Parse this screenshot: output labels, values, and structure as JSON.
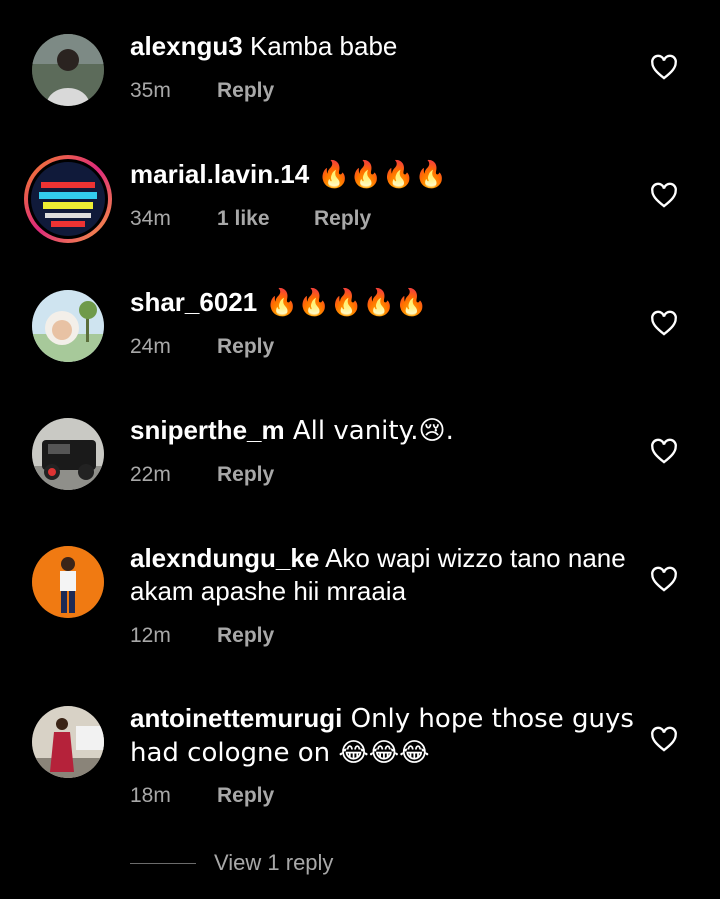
{
  "comments": [
    {
      "username": "alexngu3",
      "text": " Kamba babe",
      "time": "35m",
      "likes": "",
      "reply": "Reply",
      "avatar": "person-avatar"
    },
    {
      "username": "marial.lavin.14",
      "text": " 🔥🔥🔥🔥",
      "time": "34m",
      "likes": "1 like",
      "reply": "Reply",
      "avatar": "promo-avatar"
    },
    {
      "username": "shar_6021",
      "text": " 🔥🔥🔥🔥🔥",
      "time": "24m",
      "likes": "",
      "reply": "Reply",
      "avatar": "baby-avatar"
    },
    {
      "username": "sniperthe_m",
      "text": " All vanity.😢.",
      "time": "22m",
      "likes": "",
      "reply": "Reply",
      "avatar": "car-avatar"
    },
    {
      "username": "alexndungu_ke",
      "text": " Ako wapi wizzo tano nane akam apashe hii mraaia",
      "time": "12m",
      "likes": "",
      "reply": "Reply",
      "avatar": "person-orange-avatar"
    },
    {
      "username": "antoinettemurugi",
      "text": " Only hope those guys had cologne on 😂😂😂",
      "time": "18m",
      "likes": "",
      "reply": "Reply",
      "avatar": "woman-avatar"
    }
  ],
  "view_replies_label": "View 1 reply",
  "colors": {
    "background": "#000000",
    "secondary_text": "#a8a8a8",
    "text": "#ffffff"
  }
}
